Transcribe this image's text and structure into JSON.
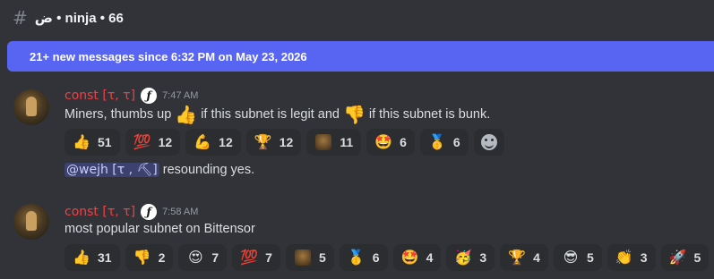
{
  "header": {
    "channel": "ض • ninja • 66"
  },
  "banner": {
    "text": "21+ new messages since 6:32 PM on May 23, 2026"
  },
  "messages": [
    {
      "author": "const [τ, τ]",
      "badge": "ƒ",
      "time": "7:47 AM",
      "text_parts": [
        "Miners, thumbs up",
        "👍",
        "if this subnet is legit and",
        "👎",
        "if this subnet is bunk."
      ],
      "reactions": [
        {
          "emoji": "👍",
          "count": "51"
        },
        {
          "emoji": "💯",
          "count": "12"
        },
        {
          "emoji": "💪",
          "count": "12"
        },
        {
          "emoji": "🏆",
          "count": "12"
        },
        {
          "emoji": "custom",
          "count": "11"
        },
        {
          "emoji": "🤩",
          "count": "6"
        },
        {
          "emoji": "🥇",
          "count": "6"
        }
      ],
      "reply": {
        "mention": "@wejh [τ , ⛏]",
        "text": "resounding yes."
      }
    },
    {
      "author": "const [τ, τ]",
      "badge": "ƒ",
      "time": "7:58 AM",
      "text": "most popular subnet on Bittensor",
      "reactions": [
        {
          "emoji": "👍",
          "count": "31"
        },
        {
          "emoji": "👎",
          "count": "2"
        },
        {
          "emoji": "😍",
          "count": "7"
        },
        {
          "emoji": "💯",
          "count": "7"
        },
        {
          "emoji": "custom",
          "count": "5"
        },
        {
          "emoji": "🥇",
          "count": "6"
        },
        {
          "emoji": "🤩",
          "count": "4"
        },
        {
          "emoji": "🥳",
          "count": "3"
        },
        {
          "emoji": "🏆",
          "count": "4"
        },
        {
          "emoji": "😎",
          "count": "5"
        },
        {
          "emoji": "👏",
          "count": "3"
        },
        {
          "emoji": "🚀",
          "count": "5"
        }
      ]
    }
  ],
  "icons": {
    "channel": "threads-hash-icon",
    "add_reaction": "smile-icon"
  },
  "colors": {
    "background": "#313338",
    "banner": "#5865f2",
    "author": "#f23f42",
    "reaction_bg": "#2b2d31"
  }
}
